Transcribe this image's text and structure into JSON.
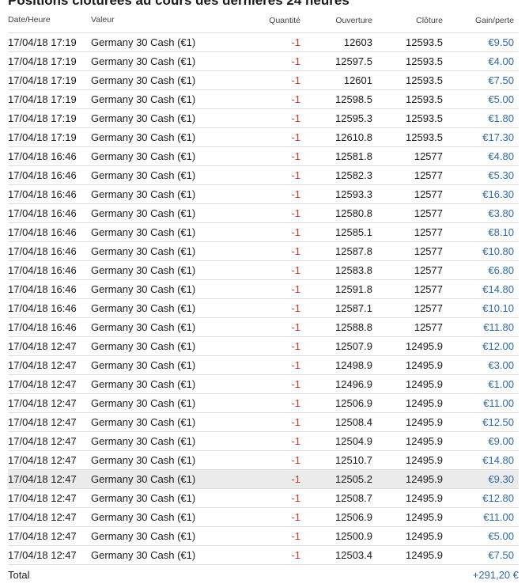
{
  "title": "Positions clôturées au cours des dernières 24 heures",
  "columns": {
    "date": "Date/Heure",
    "valeur": "Valeur",
    "quantite": "Quantité",
    "ouverture": "Ouverture",
    "cloture": "Clôture",
    "gain": "Gain/perte"
  },
  "rows": [
    {
      "date": "17/04/18 17:19",
      "valeur": "Germany 30 Cash (€1)",
      "quantite": "-1",
      "ouverture": "12603",
      "cloture": "12593.5",
      "gain": "€9.50"
    },
    {
      "date": "17/04/18 17:19",
      "valeur": "Germany 30 Cash (€1)",
      "quantite": "-1",
      "ouverture": "12597.5",
      "cloture": "12593.5",
      "gain": "€4.00"
    },
    {
      "date": "17/04/18 17:19",
      "valeur": "Germany 30 Cash (€1)",
      "quantite": "-1",
      "ouverture": "12601",
      "cloture": "12593.5",
      "gain": "€7.50"
    },
    {
      "date": "17/04/18 17:19",
      "valeur": "Germany 30 Cash (€1)",
      "quantite": "-1",
      "ouverture": "12598.5",
      "cloture": "12593.5",
      "gain": "€5.00"
    },
    {
      "date": "17/04/18 17:19",
      "valeur": "Germany 30 Cash (€1)",
      "quantite": "-1",
      "ouverture": "12595.3",
      "cloture": "12593.5",
      "gain": "€1.80"
    },
    {
      "date": "17/04/18 17:19",
      "valeur": "Germany 30 Cash (€1)",
      "quantite": "-1",
      "ouverture": "12610.8",
      "cloture": "12593.5",
      "gain": "€17.30"
    },
    {
      "date": "17/04/18 16:46",
      "valeur": "Germany 30 Cash (€1)",
      "quantite": "-1",
      "ouverture": "12581.8",
      "cloture": "12577",
      "gain": "€4.80"
    },
    {
      "date": "17/04/18 16:46",
      "valeur": "Germany 30 Cash (€1)",
      "quantite": "-1",
      "ouverture": "12582.3",
      "cloture": "12577",
      "gain": "€5.30"
    },
    {
      "date": "17/04/18 16:46",
      "valeur": "Germany 30 Cash (€1)",
      "quantite": "-1",
      "ouverture": "12593.3",
      "cloture": "12577",
      "gain": "€16.30"
    },
    {
      "date": "17/04/18 16:46",
      "valeur": "Germany 30 Cash (€1)",
      "quantite": "-1",
      "ouverture": "12580.8",
      "cloture": "12577",
      "gain": "€3.80"
    },
    {
      "date": "17/04/18 16:46",
      "valeur": "Germany 30 Cash (€1)",
      "quantite": "-1",
      "ouverture": "12585.1",
      "cloture": "12577",
      "gain": "€8.10"
    },
    {
      "date": "17/04/18 16:46",
      "valeur": "Germany 30 Cash (€1)",
      "quantite": "-1",
      "ouverture": "12587.8",
      "cloture": "12577",
      "gain": "€10.80"
    },
    {
      "date": "17/04/18 16:46",
      "valeur": "Germany 30 Cash (€1)",
      "quantite": "-1",
      "ouverture": "12583.8",
      "cloture": "12577",
      "gain": "€6.80"
    },
    {
      "date": "17/04/18 16:46",
      "valeur": "Germany 30 Cash (€1)",
      "quantite": "-1",
      "ouverture": "12591.8",
      "cloture": "12577",
      "gain": "€14.80"
    },
    {
      "date": "17/04/18 16:46",
      "valeur": "Germany 30 Cash (€1)",
      "quantite": "-1",
      "ouverture": "12587.1",
      "cloture": "12577",
      "gain": "€10.10"
    },
    {
      "date": "17/04/18 16:46",
      "valeur": "Germany 30 Cash (€1)",
      "quantite": "-1",
      "ouverture": "12588.8",
      "cloture": "12577",
      "gain": "€11.80"
    },
    {
      "date": "17/04/18 12:47",
      "valeur": "Germany 30 Cash (€1)",
      "quantite": "-1",
      "ouverture": "12507.9",
      "cloture": "12495.9",
      "gain": "€12.00"
    },
    {
      "date": "17/04/18 12:47",
      "valeur": "Germany 30 Cash (€1)",
      "quantite": "-1",
      "ouverture": "12498.9",
      "cloture": "12495.9",
      "gain": "€3.00"
    },
    {
      "date": "17/04/18 12:47",
      "valeur": "Germany 30 Cash (€1)",
      "quantite": "-1",
      "ouverture": "12496.9",
      "cloture": "12495.9",
      "gain": "€1.00"
    },
    {
      "date": "17/04/18 12:47",
      "valeur": "Germany 30 Cash (€1)",
      "quantite": "-1",
      "ouverture": "12506.9",
      "cloture": "12495.9",
      "gain": "€11.00"
    },
    {
      "date": "17/04/18 12:47",
      "valeur": "Germany 30 Cash (€1)",
      "quantite": "-1",
      "ouverture": "12508.4",
      "cloture": "12495.9",
      "gain": "€12.50"
    },
    {
      "date": "17/04/18 12:47",
      "valeur": "Germany 30 Cash (€1)",
      "quantite": "-1",
      "ouverture": "12504.9",
      "cloture": "12495.9",
      "gain": "€9.00"
    },
    {
      "date": "17/04/18 12:47",
      "valeur": "Germany 30 Cash (€1)",
      "quantite": "-1",
      "ouverture": "12510.7",
      "cloture": "12495.9",
      "gain": "€14.80"
    },
    {
      "date": "17/04/18 12:47",
      "valeur": "Germany 30 Cash (€1)",
      "quantite": "-1",
      "ouverture": "12505.2",
      "cloture": "12495.9",
      "gain": "€9.30",
      "highlighted": true
    },
    {
      "date": "17/04/18 12:47",
      "valeur": "Germany 30 Cash (€1)",
      "quantite": "-1",
      "ouverture": "12508.7",
      "cloture": "12495.9",
      "gain": "€12.80"
    },
    {
      "date": "17/04/18 12:47",
      "valeur": "Germany 30 Cash (€1)",
      "quantite": "-1",
      "ouverture": "12506.9",
      "cloture": "12495.9",
      "gain": "€11.00"
    },
    {
      "date": "17/04/18 12:47",
      "valeur": "Germany 30 Cash (€1)",
      "quantite": "-1",
      "ouverture": "12500.9",
      "cloture": "12495.9",
      "gain": "€5.00"
    },
    {
      "date": "17/04/18 12:47",
      "valeur": "Germany 30 Cash (€1)",
      "quantite": "-1",
      "ouverture": "12503.4",
      "cloture": "12495.9",
      "gain": "€7.50"
    }
  ],
  "total": {
    "label": "Total",
    "value": "+291,20 €"
  },
  "colors": {
    "negative": "#d03a2c",
    "gain": "#2f6aa8",
    "highlight": "#ebebeb"
  }
}
